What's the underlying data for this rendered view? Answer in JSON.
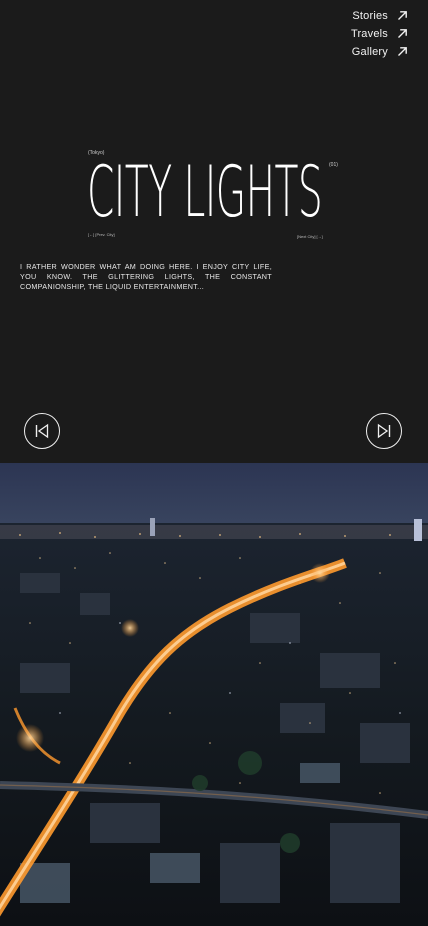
{
  "nav": {
    "items": [
      {
        "label": "Stories",
        "icon": "arrow-up-right-icon"
      },
      {
        "label": "Travels",
        "icon": "arrow-up-right-icon"
      },
      {
        "label": "Gallery",
        "icon": "arrow-up-right-icon"
      }
    ]
  },
  "hero": {
    "location": "(Tokyo)",
    "title": "CITY LIGHTS",
    "index": "(01)",
    "prev_label": "[←] [Prev. City]",
    "next_label": "[Next City] [→]",
    "intro": "I rather wonder what am doing here. I enjoy city life, you know. The glittering lights, the constant companionship, the liquid entertainment..."
  },
  "controls": {
    "prev_icon": "skip-back-icon",
    "next_icon": "skip-forward-icon"
  },
  "photo": {
    "subject": "night-city-aerial-image"
  },
  "colors": {
    "background": "#1b1b1b",
    "text": "#ffffff",
    "sky": "#2a3550",
    "street_light": "#ff9a2e"
  }
}
